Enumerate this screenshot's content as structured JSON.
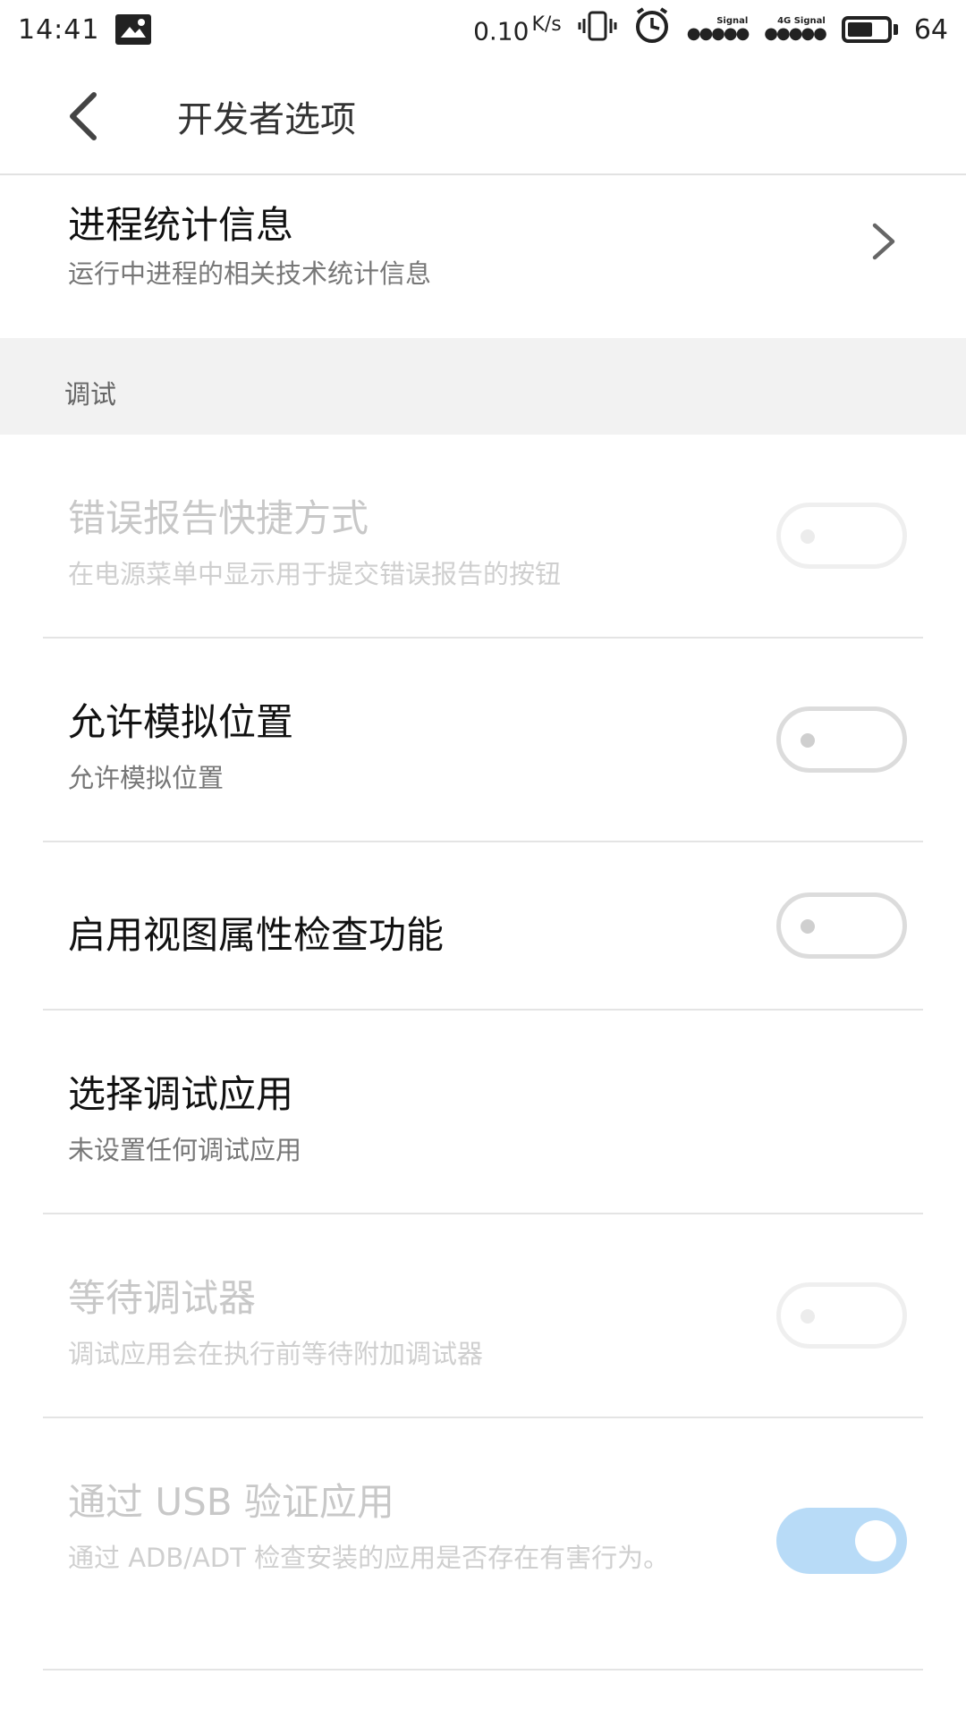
{
  "status_bar": {
    "time": "14:41",
    "net_speed": "0.10",
    "net_unit": "K/s",
    "signal_label_1": "Signal",
    "signal_label_2": "4G Signal",
    "battery_percent": "64"
  },
  "header": {
    "title": "开发者选项"
  },
  "rows": {
    "process_stats": {
      "title": "进程统计信息",
      "subtitle": "运行中进程的相关技术统计信息"
    },
    "section_debug": "调试",
    "bug_report": {
      "title": "错误报告快捷方式",
      "subtitle": "在电源菜单中显示用于提交错误报告的按钮",
      "enabled": false,
      "on": false
    },
    "mock_location": {
      "title": "允许模拟位置",
      "subtitle": "允许模拟位置",
      "enabled": true,
      "on": false
    },
    "view_attr": {
      "title": "启用视图属性检查功能",
      "enabled": true,
      "on": false
    },
    "debug_app": {
      "title": "选择调试应用",
      "subtitle": "未设置任何调试应用"
    },
    "wait_debugger": {
      "title": "等待调试器",
      "subtitle": "调试应用会在执行前等待附加调试器",
      "enabled": false,
      "on": false
    },
    "verify_usb": {
      "title": "通过 USB 验证应用",
      "subtitle": "通过 ADB/ADT 检查安装的应用是否存在有害行为。",
      "enabled": false,
      "on": true
    }
  },
  "colors": {
    "toggle_on": "#b8dbf7",
    "section_bg": "#f2f2f2",
    "disabled_text": "#c8c8c8"
  },
  "icons": {
    "back": "chevron-left-icon",
    "chevron": "chevron-right-icon"
  }
}
